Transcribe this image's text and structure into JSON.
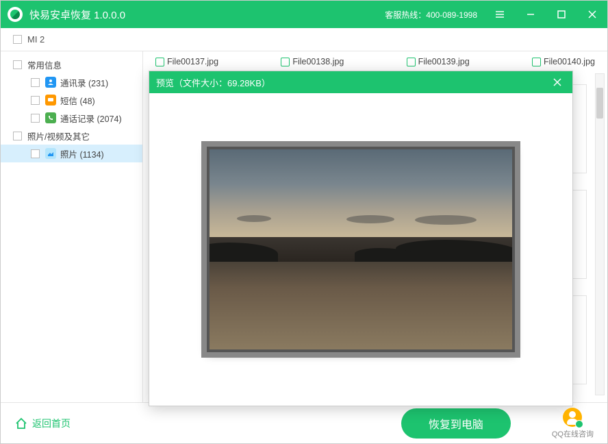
{
  "titlebar": {
    "app_title": "快易安卓恢复  1.0.0.0",
    "hotline": "客服热线：400-089-1998"
  },
  "toolbar": {
    "device_label": "MI 2"
  },
  "sidebar": {
    "group_common": "常用信息",
    "contacts": "通讯录 (231)",
    "sms": "短信 (48)",
    "calllog": "通话记录 (2074)",
    "group_media": "照片/视频及其它",
    "photo": "照片 (1134)"
  },
  "files": {
    "f1": "File00137.jpg",
    "f2": "File00138.jpg",
    "f3": "File00139.jpg",
    "f4": "File00140.jpg"
  },
  "preview": {
    "header": "预览（文件大小：69.28KB）"
  },
  "bottombar": {
    "back_home": "返回首页",
    "recover": "恢复到电脑",
    "qq": "QQ在线咨询"
  }
}
